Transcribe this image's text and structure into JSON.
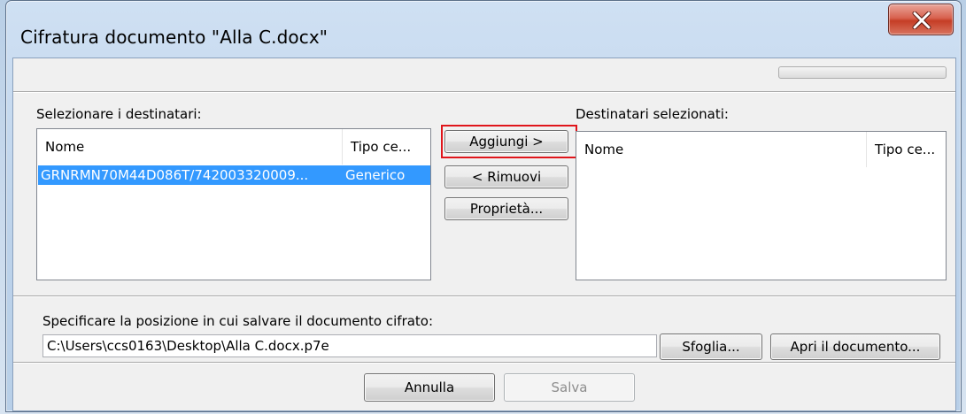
{
  "window": {
    "title": "Cifratura documento \"Alla C.docx\""
  },
  "recipients": {
    "label": "Selezionare i destinatari:",
    "columns": [
      "Nome",
      "Tipo ce..."
    ],
    "rows": [
      {
        "name": "GRNRMN70M44D086T/742003320009...",
        "type": "Generico",
        "selected": true
      }
    ]
  },
  "selected_recipients": {
    "label": "Destinatari selezionati:",
    "columns": [
      "Nome",
      "Tipo ce..."
    ],
    "rows": []
  },
  "buttons": {
    "add": "Aggiungi >",
    "remove": "< Rimuovi",
    "properties": "Proprietà...",
    "browse": "Sfoglia...",
    "open_document": "Apri il documento...",
    "cancel": "Annulla",
    "save": "Salva"
  },
  "save_location": {
    "label": "Specificare la posizione in cui salvare il documento cifrato:",
    "path": "C:\\Users\\ccs0163\\Desktop\\Alla C.docx.p7e"
  },
  "colors": {
    "selection": "#3399ff",
    "highlight_border": "#e0151b",
    "close_button": "#c53d25"
  }
}
